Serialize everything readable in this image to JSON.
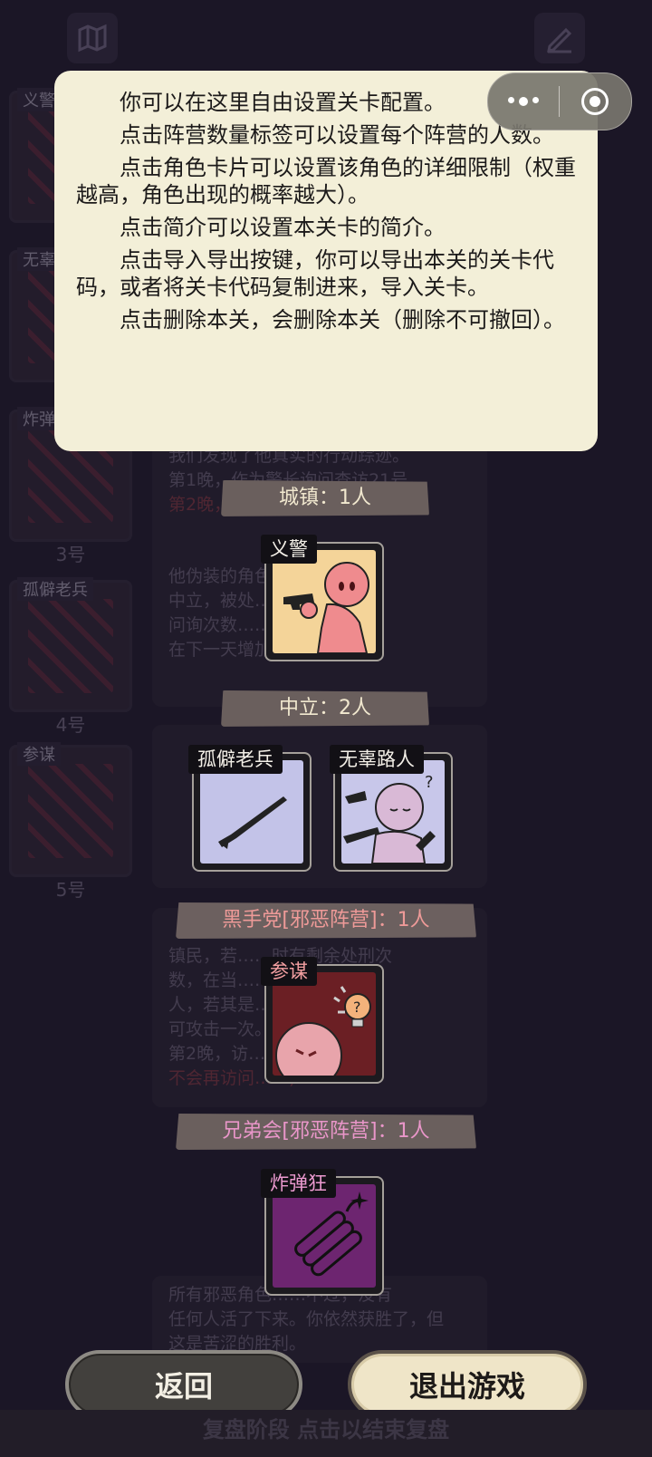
{
  "tooltip": {
    "paragraphs": [
      "你可以在这里自由设置关卡配置。",
      "点击阵营数量标签可以设置每个阵营的人数。",
      "点击角色卡片可以设置该角色的详细限制（权重越高，角色出现的概率越大）。",
      "点击简介可以设置本关卡的简介。",
      "点击导入导出按键，你可以导出本关的关卡代码，或者将关卡代码复制进来，导入关卡。",
      "点击删除本关，会删除本关（删除不可撤回）。"
    ]
  },
  "capsule": {
    "more_icon": "more-dots-icon",
    "close_icon": "close-target-icon"
  },
  "top_icons": {
    "left": "map-icon",
    "right": "edit-pen-icon"
  },
  "background": {
    "side_cards": [
      {
        "label": "义警",
        "num": ""
      },
      {
        "label": "无辜",
        "num": ""
      },
      {
        "label": "炸弹",
        "num": "3号"
      },
      {
        "label": "孤僻老兵",
        "num": "4号"
      },
      {
        "label": "参谋",
        "num": "5号"
      }
    ],
    "log_lines_1": [
      "我们发现了他真实的行动踪迹。",
      "第1晚，作为警长询问查访21号",
      "第2晚，……"
    ],
    "log_lines_2": [
      "他伪装的角色……",
      "中立，被处……次减少两次",
      "问询次数……的原因后，",
      "在下一天增加一次处刑次数。"
    ],
    "log_lines_3": [
      "镇民，若……时有剩余处刑次",
      "数，在当……不问询的",
      "人，若其是……对方。只",
      "可攻击一次。",
      "第2晚，访……对方！(之后",
      "不会再访问……)"
    ],
    "log_end": [
      "所有邪恶角色……不过，没有",
      "任何人活了下来。你依然获胜了，但",
      "这是苦涩的胜利。"
    ]
  },
  "factions": [
    {
      "label": "城镇：1人",
      "style": "town"
    },
    {
      "label": "中立：2人",
      "style": "neutral"
    },
    {
      "label": "黑手党[邪恶阵营]：1人",
      "style": "evil"
    },
    {
      "label": "兄弟会[邪恶阵营]：1人",
      "style": "brother"
    }
  ],
  "roles": {
    "vigilante": {
      "name": "义警",
      "art_color": "#f4d499"
    },
    "veteran": {
      "name": "孤僻老兵",
      "art_color": "#c3c3e8"
    },
    "bystander": {
      "name": "无辜路人",
      "art_color": "#c8c7ea"
    },
    "advisor": {
      "name": "参谋",
      "art_color": "#6b1f24"
    },
    "bomber": {
      "name": "炸弹狂",
      "art_color": "#6d2570"
    }
  },
  "buttons": {
    "back": "返回",
    "exit": "退出游戏"
  },
  "review_bar": "复盘阶段 点击以结束复盘"
}
